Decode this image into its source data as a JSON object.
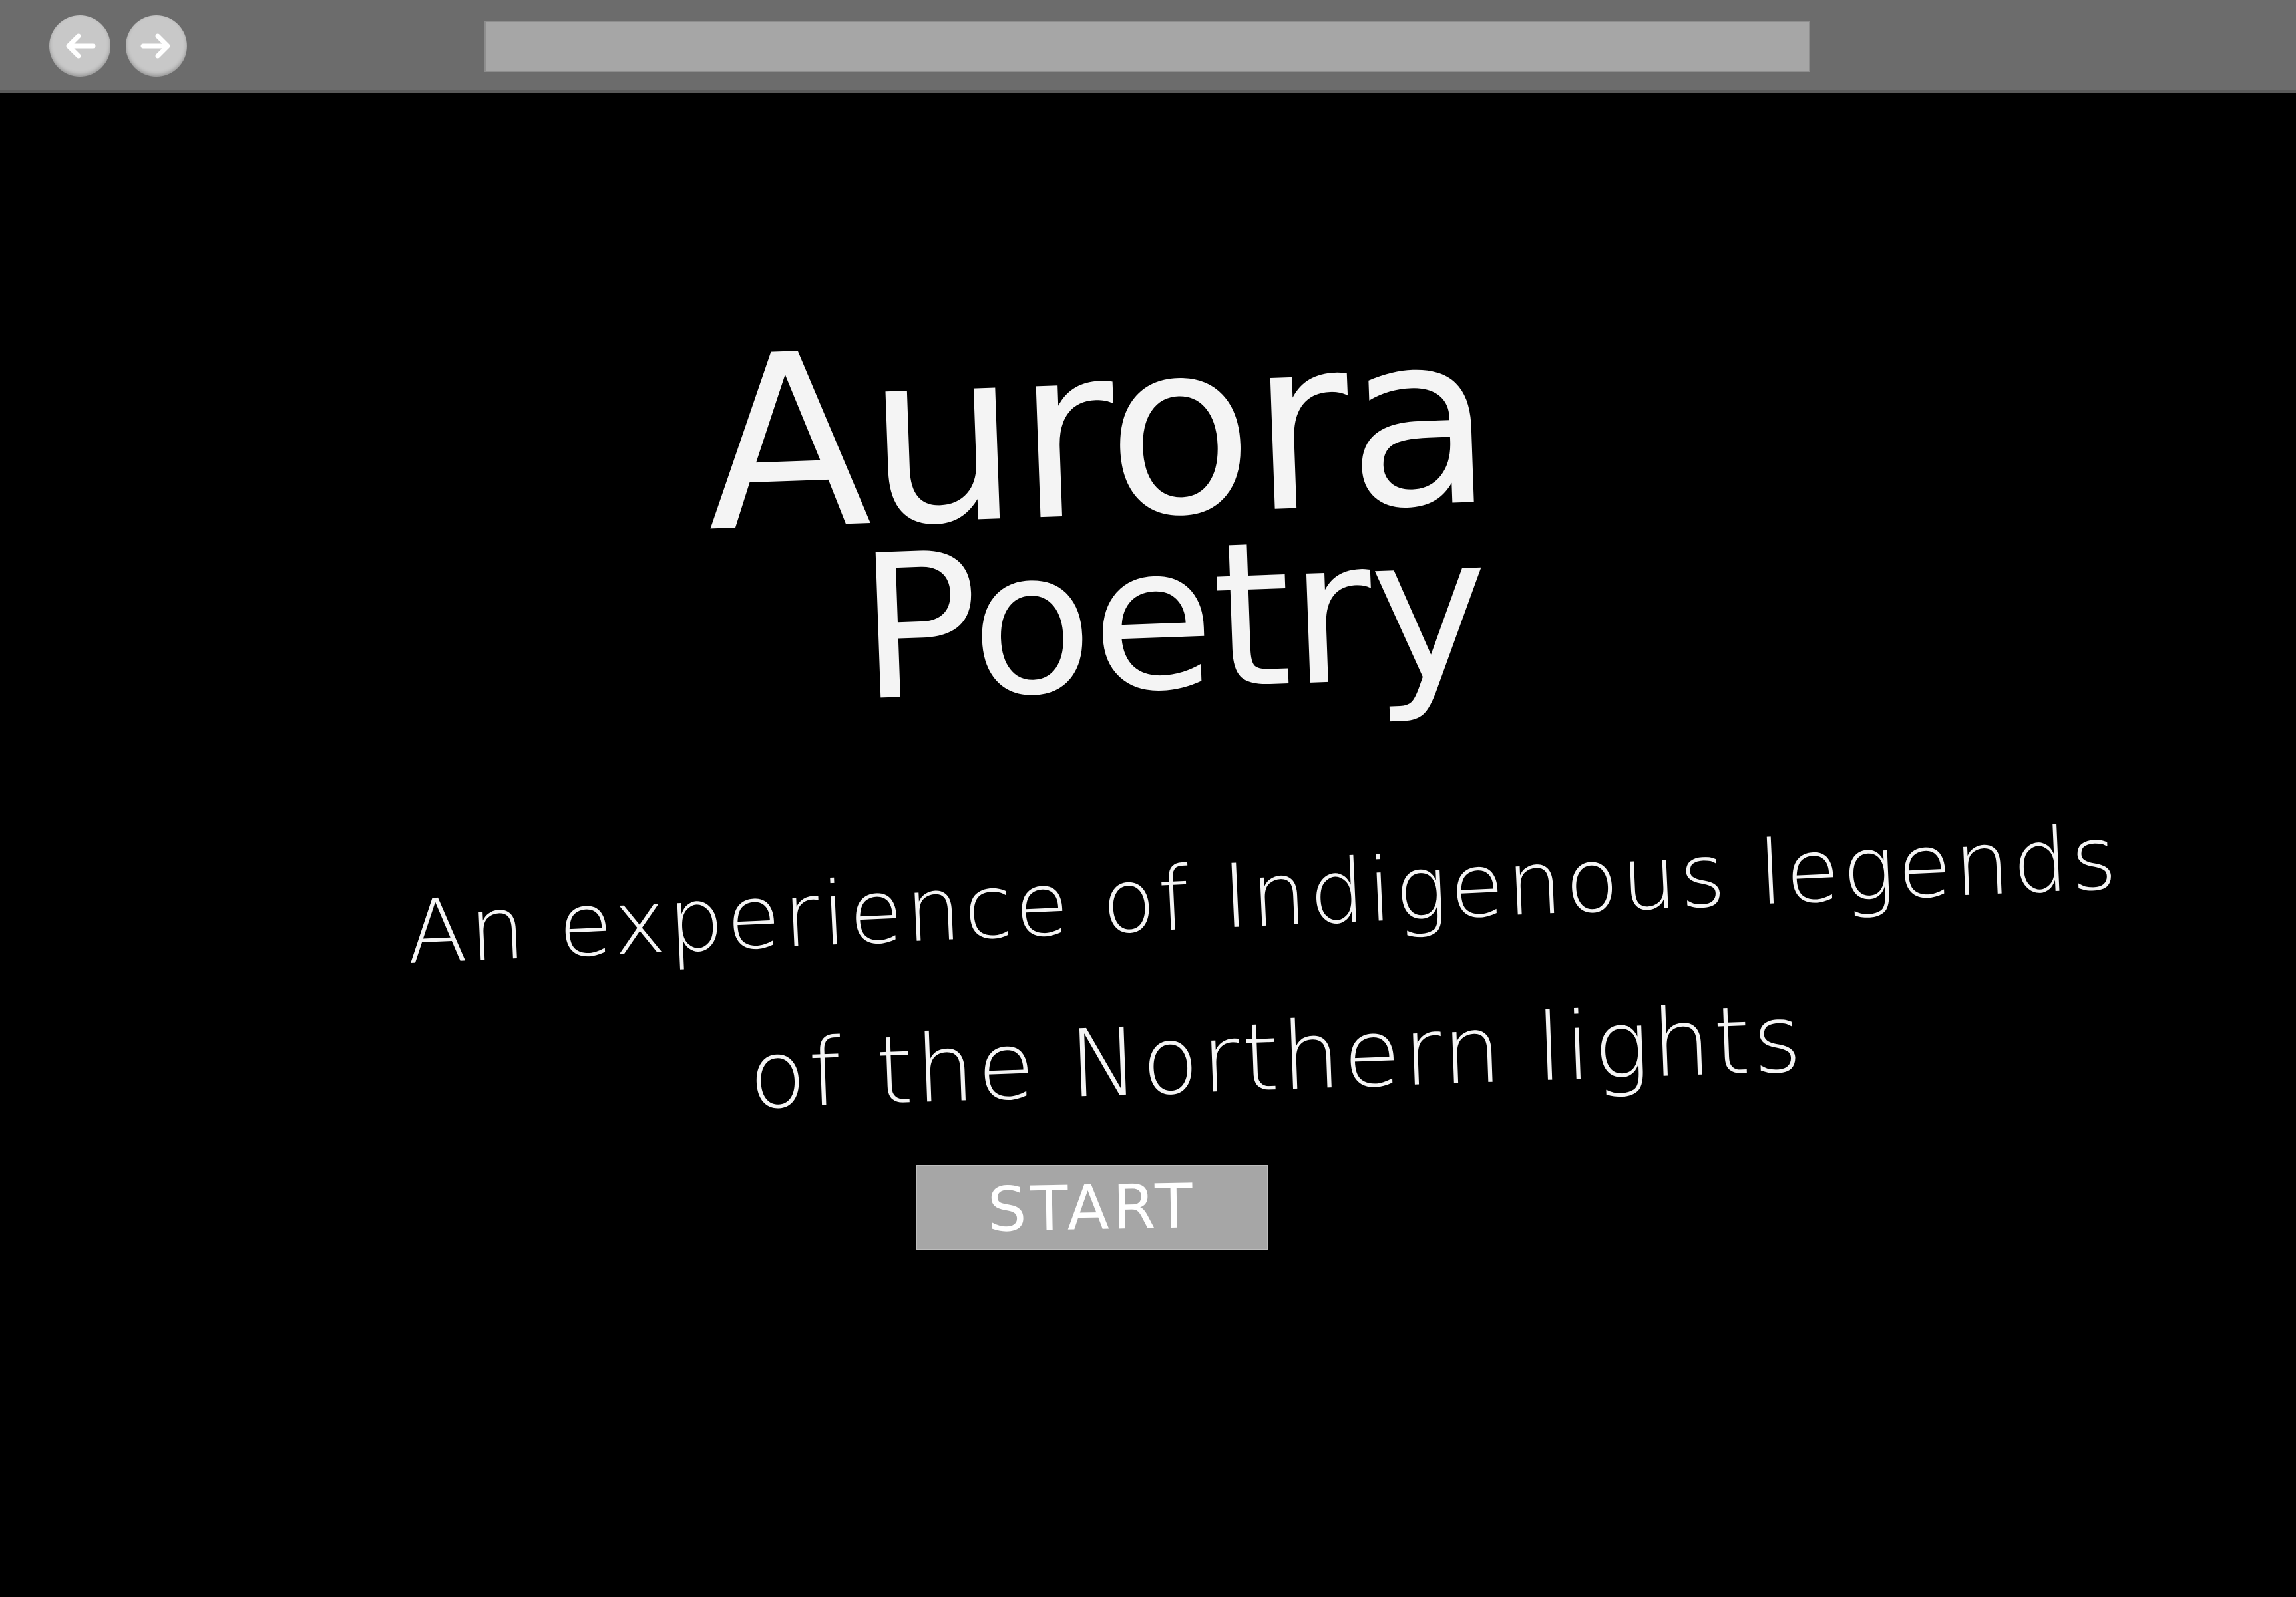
{
  "browser": {
    "back_icon": "arrow-left-icon",
    "forward_icon": "arrow-right-icon",
    "address_value": ""
  },
  "page": {
    "title_line1": "Aurora",
    "title_line2": "Poetry",
    "subtitle_line1": "An experience of Indigenous legends",
    "subtitle_line2": "of the Northern lights",
    "start_label": "START"
  },
  "colors": {
    "background": "#000000",
    "toolbar": "#6c6c6c",
    "address_bar": "#a6a6a6",
    "button": "#a6a6a6",
    "text": "#f4f4f4"
  }
}
